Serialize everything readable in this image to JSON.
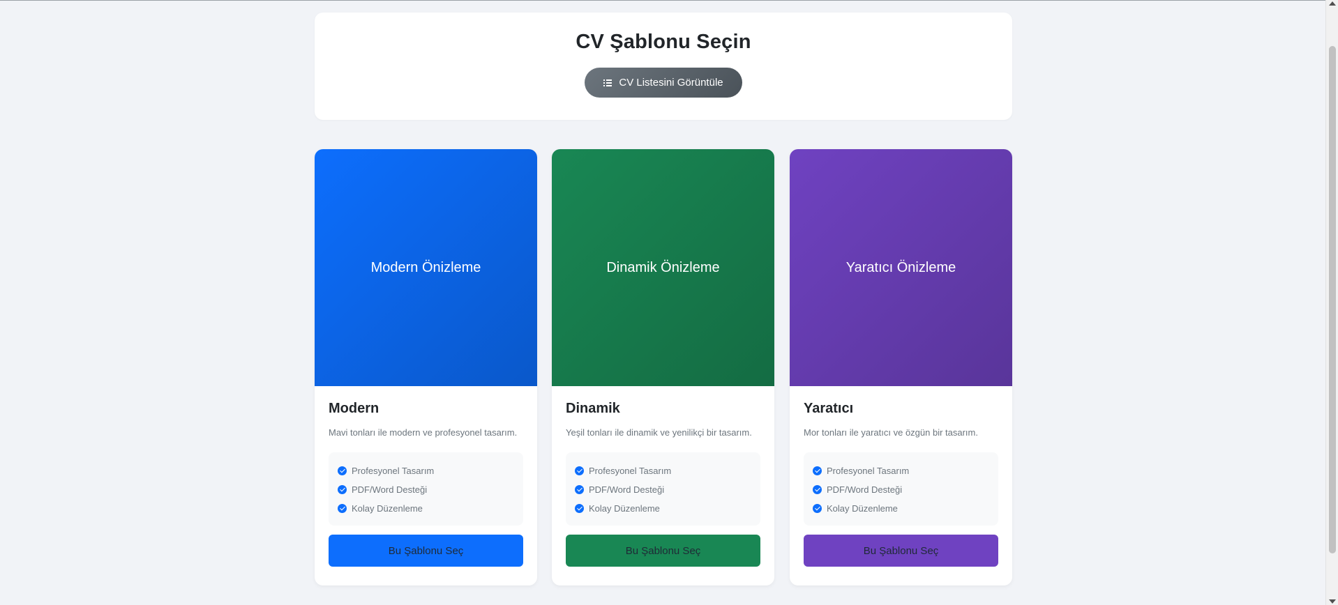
{
  "header": {
    "title": "CV Şablonu Seçin",
    "list_button_label": "CV Listesini Görüntüle",
    "list_button_icon": "list-icon"
  },
  "templates": [
    {
      "preview_label": "Modern Önizleme",
      "title": "Modern",
      "description": "Mavi tonları ile modern ve profesyonel tasarım.",
      "features": [
        "Profesyonel Tasarım",
        "PDF/Word Desteği",
        "Kolay Düzenleme"
      ],
      "button_label": "Bu Şablonu Seç",
      "color": "#0d6efd"
    },
    {
      "preview_label": "Dinamik Önizleme",
      "title": "Dinamik",
      "description": "Yeşil tonları ile dinamik ve yenilikçi bir tasarım.",
      "features": [
        "Profesyonel Tasarım",
        "PDF/Word Desteği",
        "Kolay Düzenleme"
      ],
      "button_label": "Bu Şablonu Seç",
      "color": "#198754"
    },
    {
      "preview_label": "Yaratıcı Önizleme",
      "title": "Yaratıcı",
      "description": "Mor tonları ile yaratıcı ve özgün bir tasarım.",
      "features": [
        "Profesyonel Tasarım",
        "PDF/Word Desteği",
        "Kolay Düzenleme"
      ],
      "button_label": "Bu Şablonu Seç",
      "color": "#6f42c1"
    }
  ],
  "feature_icon": "check-circle-icon"
}
